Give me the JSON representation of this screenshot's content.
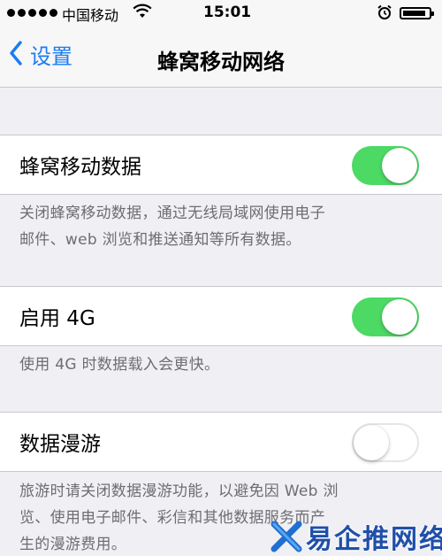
{
  "status_bar": {
    "carrier": "中国移动",
    "time": "15:01",
    "battery_level": 0.9
  },
  "nav": {
    "back_label": "设置",
    "title": "蜂窝移动网络"
  },
  "settings": {
    "cellular_data": {
      "label": "蜂窝移动数据",
      "enabled": true,
      "footer_line1": "关闭蜂窝移动数据，通过无线局域网使用电子",
      "footer_line2": "邮件、web 浏览和推送通知等所有数据。"
    },
    "enable_4g": {
      "label": "启用 4G",
      "enabled": true,
      "footer": "使用 4G 时数据载入会更快。"
    },
    "data_roaming": {
      "label": "数据漫游",
      "enabled": false,
      "footer_line1": "旅游时请关闭数据漫游功能，以避免因 Web 浏",
      "footer_line2": "览、使用电子邮件、彩信和其他数据服务而产",
      "footer_line3": "生的漫游费用。"
    }
  },
  "watermark": {
    "text": "易企推网络"
  },
  "colors": {
    "accent": "#1a7cf5",
    "toggle_on": "#4cd964",
    "background": "#efeff4",
    "footer_text": "#6d6d72"
  }
}
